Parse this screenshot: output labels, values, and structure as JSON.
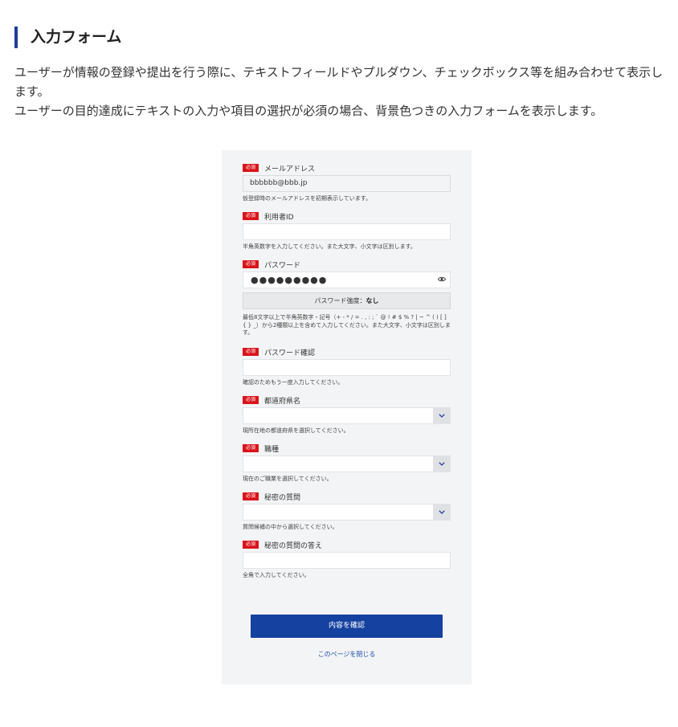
{
  "section": {
    "title": "入力フォーム",
    "description_1": "ユーザーが情報の登録や提出を行う際に、テキストフィールドやプルダウン、チェックボックス等を組み合わせて表示します。",
    "description_2": "ユーザーの目的達成にテキストの入力や項目の選択が必須の場合、背景色つきの入力フォームを表示します。"
  },
  "form": {
    "required_badge": "必須",
    "email": {
      "label": "メールアドレス",
      "value": "bbbbbb@bbb.jp",
      "help": "仮登録時のメールアドレスを初期表示しています。"
    },
    "user_id": {
      "label": "利用者ID",
      "value": "",
      "help": "半角英数字を入力してください。また大文字、小文字は区別します。"
    },
    "password": {
      "label": "パスワード",
      "value": "●●●●●●●●●",
      "icon": "eye-icon",
      "strength_label": "パスワード強度：",
      "strength_value": "なし",
      "help": "最低8文字以上で半角英数字・記号（+ - * / = . , : ; ` @ ! # $ % ? | ~ ^ ( ) [ ] { } _）から2種類以上を含めて入力してください。また大文字、小文字は区別します。"
    },
    "password_confirm": {
      "label": "パスワード確認",
      "value": "",
      "help": "確認のためもう一度入力してください。"
    },
    "prefecture": {
      "label": "都道府県名",
      "selected": "",
      "icon": "chevron-down-icon",
      "help": "現所在地の都道府県を選択してください。"
    },
    "occupation": {
      "label": "職種",
      "selected": "",
      "icon": "chevron-down-icon",
      "help": "現在のご職業を選択してください。"
    },
    "secret_question": {
      "label": "秘密の質問",
      "selected": "",
      "icon": "chevron-down-icon",
      "help": "質問候補の中から選択してください。"
    },
    "secret_answer": {
      "label": "秘密の質問の答え",
      "value": "",
      "help": "全角で入力してください。"
    },
    "submit_label": "内容を確認",
    "close_label": "このページを閉じる"
  },
  "colors": {
    "accent": "#1541a0",
    "required": "#d9131b",
    "card_bg": "#f3f4f5",
    "link": "#1d4fb0"
  }
}
